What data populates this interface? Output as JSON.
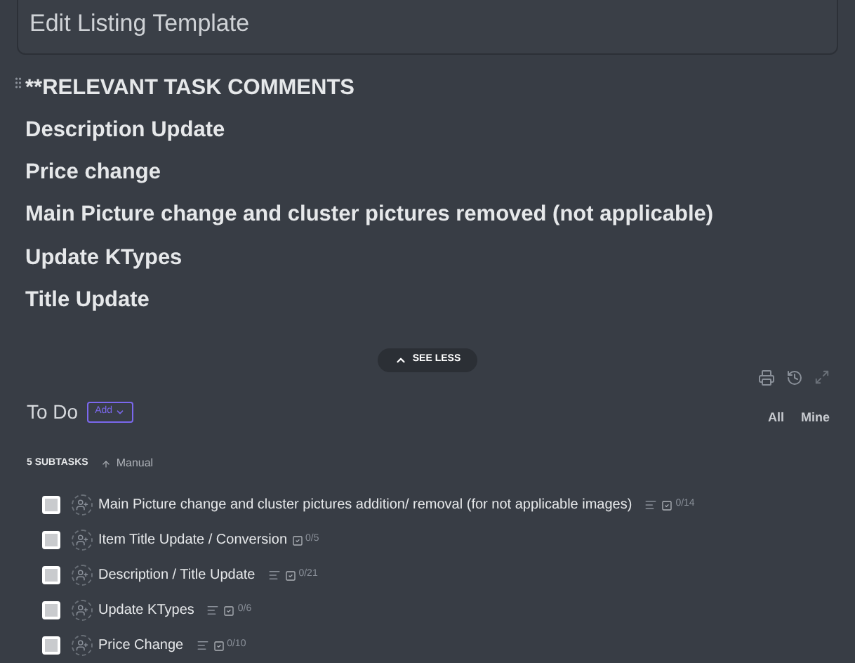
{
  "title_field": {
    "value": "Edit Listing Template"
  },
  "description": {
    "heading": "**RELEVANT TASK COMMENTS",
    "lines": [
      "Description Update",
      "Price change",
      "Main Picture change and cluster pictures removed (not applicable)",
      "Update KTypes",
      "Title Update"
    ]
  },
  "see_less": "SEE LESS",
  "todo": {
    "title": "To Do",
    "add_button": "Add",
    "filters": [
      "All",
      "Mine"
    ]
  },
  "subtasks": {
    "count": "5 SUBTASKS",
    "sort": "Manual",
    "items": [
      {
        "name": "Main Picture change and cluster pictures addition/ removal (for not applicable images)",
        "checked": false,
        "has_description": true,
        "checklist": "0/14"
      },
      {
        "name": "Item Title Update / Conversion",
        "checked": false,
        "has_description": false,
        "checklist": "0/5"
      },
      {
        "name": "Description / Title Update",
        "checked": false,
        "has_description": true,
        "checklist": "0/21"
      },
      {
        "name": "Update KTypes",
        "checked": false,
        "has_description": true,
        "checklist": "0/6"
      },
      {
        "name": "Price Change",
        "checked": false,
        "has_description": true,
        "checklist": "0/10"
      }
    ]
  }
}
